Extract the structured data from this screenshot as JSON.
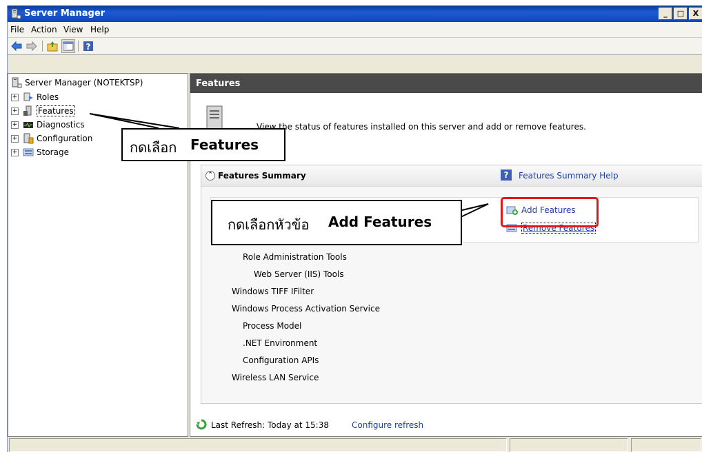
{
  "window": {
    "title": "Server Manager",
    "buttons": [
      "_",
      "□",
      "X"
    ]
  },
  "menu": [
    "File",
    "Action",
    "View",
    "Help"
  ],
  "toolbar": {
    "icons": [
      "back-arrow-icon",
      "forward-arrow-icon",
      "up-folder-icon",
      "show-hide-tree-icon",
      "help-icon"
    ]
  },
  "tree": {
    "root": "Server Manager (NOTEKTSP)",
    "items": [
      {
        "label": "Roles",
        "expander": "+"
      },
      {
        "label": "Features",
        "expander": "+",
        "selected": true
      },
      {
        "label": "Diagnostics",
        "expander": "+"
      },
      {
        "label": "Configuration",
        "expander": "+"
      },
      {
        "label": "Storage",
        "expander": "+"
      }
    ]
  },
  "main": {
    "header": "Features",
    "intro": "View the status of features installed on this server and add or remove features.",
    "summary": {
      "title": "Features Summary",
      "help_link": "Features Summary Help",
      "actions": [
        "Add Features",
        "Remove Features"
      ],
      "features": [
        "Role Administration Tools",
        "Web Server (IIS) Tools",
        "Windows TIFF IFilter",
        "Windows Process Activation Service",
        "Process Model",
        ".NET Environment",
        "Configuration APIs",
        "Wireless LAN Service"
      ]
    },
    "refresh": {
      "text": "Last Refresh: Today at 15:38",
      "link": "Configure refresh"
    }
  },
  "callouts": {
    "one": {
      "thai": "กดเลือก",
      "bold": "Features"
    },
    "two": {
      "thai": "กดเลือกหัวข้อ",
      "bold": "Add Features"
    }
  },
  "colors": {
    "highlight": "#e3161b",
    "link": "#1c3fa8",
    "header": "#4a4a4a"
  }
}
